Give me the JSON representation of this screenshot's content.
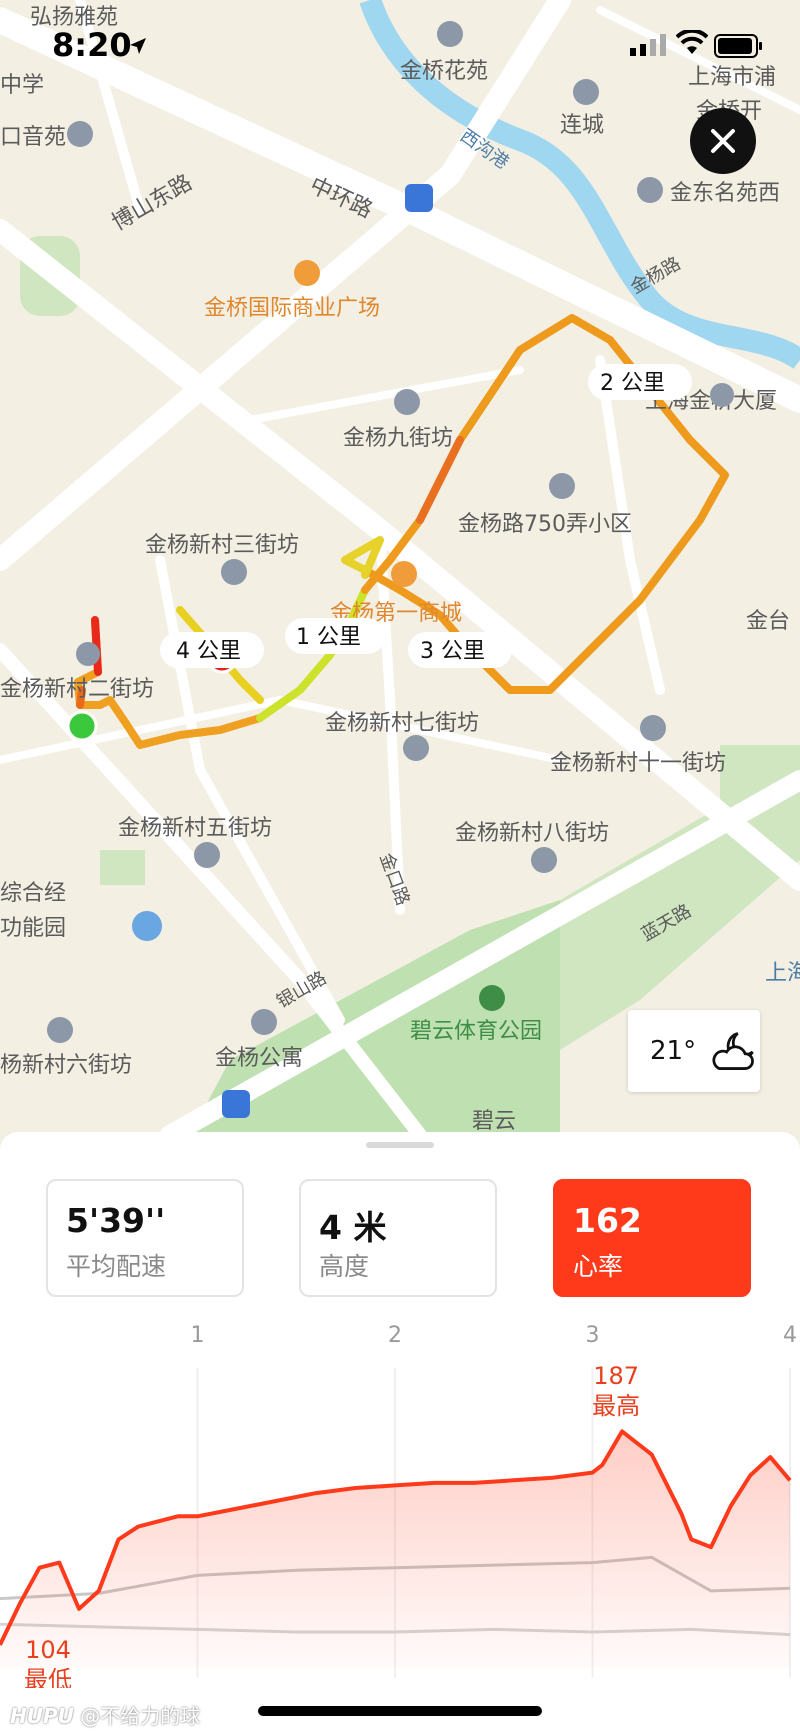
{
  "status_bar": {
    "time": "8:20"
  },
  "map": {
    "labels": [
      {
        "text": "弘扬雅苑"
      },
      {
        "text": "金桥花苑"
      },
      {
        "text": "上海市浦"
      },
      {
        "text": "金桥开"
      },
      {
        "text": "中学"
      },
      {
        "text": "口音苑"
      },
      {
        "text": "西沟港"
      },
      {
        "text": "连城"
      },
      {
        "text": "博山东路"
      },
      {
        "text": "中环路"
      },
      {
        "text": "金东名苑西"
      },
      {
        "text": "金杨路"
      },
      {
        "text": "金桥国际商业广场"
      },
      {
        "text": "金杨九街坊"
      },
      {
        "text": "上海金桥大厦"
      },
      {
        "text": "金杨路750弄小区"
      },
      {
        "text": "金杨新村三街坊"
      },
      {
        "text": "金杨第一商城"
      },
      {
        "text": "金台"
      },
      {
        "text": "金杨新村二街坊"
      },
      {
        "text": "金杨新村七街坊"
      },
      {
        "text": "金杨新村十一街坊"
      },
      {
        "text": "金杨新村五街坊"
      },
      {
        "text": "金杨新村八街坊"
      },
      {
        "text": "金口路"
      },
      {
        "text": "综合经"
      },
      {
        "text": "功能园"
      },
      {
        "text": "蓝天路"
      },
      {
        "text": "银山路"
      },
      {
        "text": "碧云体育公园"
      },
      {
        "text": "金杨公寓"
      },
      {
        "text": "杨新村六街坊"
      },
      {
        "text": "碧云"
      },
      {
        "text": "上海"
      }
    ],
    "km_markers": [
      "1 公里",
      "2 公里",
      "3 公里",
      "4 公里"
    ],
    "weather": {
      "temperature": "21°",
      "icon": "partly-cloudy-night-icon"
    }
  },
  "metrics": [
    {
      "value": "5'39''",
      "label": "平均配速"
    },
    {
      "value": "4 米",
      "label": "高度"
    },
    {
      "value": "162",
      "label": "心率"
    }
  ],
  "chart_data": {
    "type": "line",
    "x_ticks": [
      "1",
      "2",
      "3",
      "4"
    ],
    "series": [
      {
        "color": "#ff3a1a",
        "x": [
          0,
          0.1,
          0.2,
          0.3,
          0.4,
          0.5,
          0.6,
          0.7,
          0.8,
          0.9,
          1.0,
          1.2,
          1.4,
          1.6,
          1.8,
          2.0,
          2.2,
          2.4,
          2.6,
          2.8,
          3.0,
          3.05,
          3.15,
          3.3,
          3.45,
          3.5,
          3.6,
          3.7,
          3.8,
          3.9,
          4.0
        ],
        "values": [
          104,
          120,
          134,
          136,
          118,
          125,
          145,
          150,
          152,
          154,
          154,
          157,
          160,
          163,
          165,
          166,
          167,
          167,
          168,
          169,
          171,
          174,
          187,
          178,
          155,
          145,
          142,
          158,
          170,
          177,
          168
        ]
      },
      {
        "color": "#c8c8c8",
        "x": [
          0,
          0.5,
          1.0,
          1.5,
          2.0,
          2.5,
          3.0,
          3.3,
          3.6,
          4.0
        ],
        "values": [
          122,
          124,
          131,
          133,
          134,
          135,
          136,
          138,
          125,
          126
        ]
      },
      {
        "color": "#d5d5d5",
        "x": [
          0,
          0.5,
          1.0,
          1.5,
          2.0,
          2.5,
          3.0,
          3.5,
          4.0
        ],
        "values": [
          112,
          111,
          110,
          109,
          109,
          110,
          109,
          110,
          108
        ]
      }
    ],
    "annotations": [
      {
        "value": "187",
        "label": "最高"
      },
      {
        "value": "104",
        "label": "最低"
      }
    ],
    "xlim": [
      0,
      4
    ],
    "ylim": [
      95,
      200
    ],
    "accent": "#ff3a1a"
  },
  "watermark": {
    "brand": "HUPU",
    "text": "@不给力的球"
  }
}
